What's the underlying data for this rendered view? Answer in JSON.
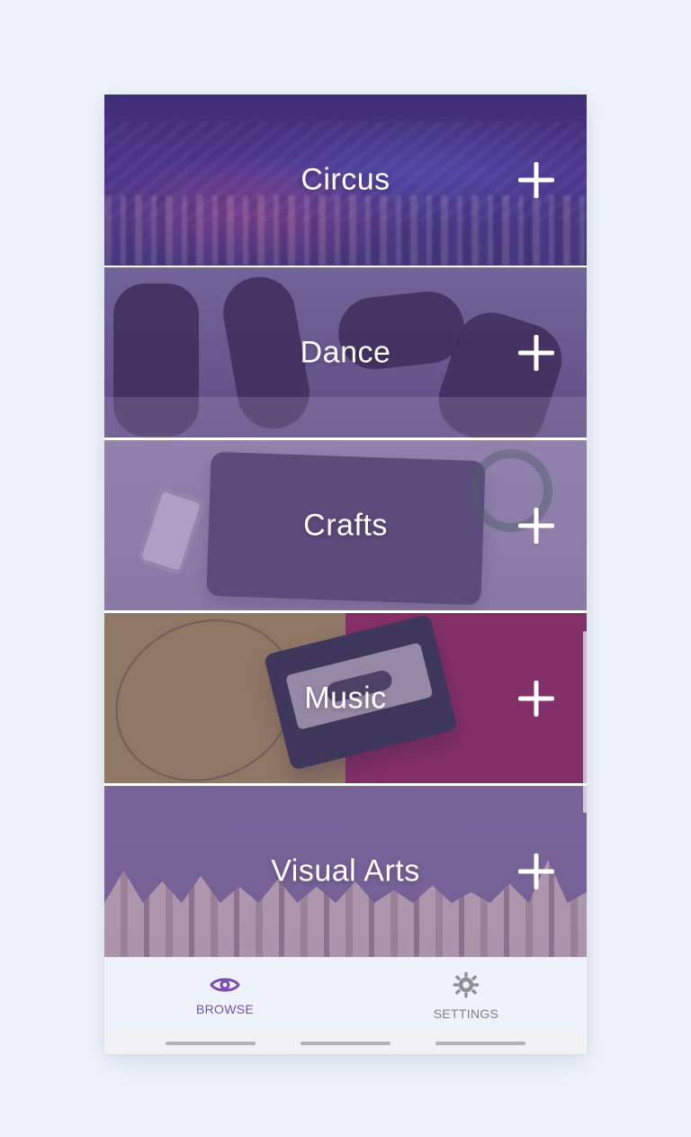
{
  "categories": [
    {
      "label": "Circus"
    },
    {
      "label": "Dance"
    },
    {
      "label": "Crafts"
    },
    {
      "label": "Music"
    },
    {
      "label": "Visual Arts"
    }
  ],
  "bottom_nav": {
    "browse": {
      "label": "BROWSE",
      "icon": "eye-icon",
      "active": true,
      "color": "#7a4bb0"
    },
    "settings": {
      "label": "SETTINGS",
      "icon": "gear-icon",
      "active": false,
      "color": "#7c7f86"
    }
  },
  "theme": {
    "overlay": "#5c468c",
    "background": "#eef3fb",
    "accent": "#7a4bb0"
  }
}
